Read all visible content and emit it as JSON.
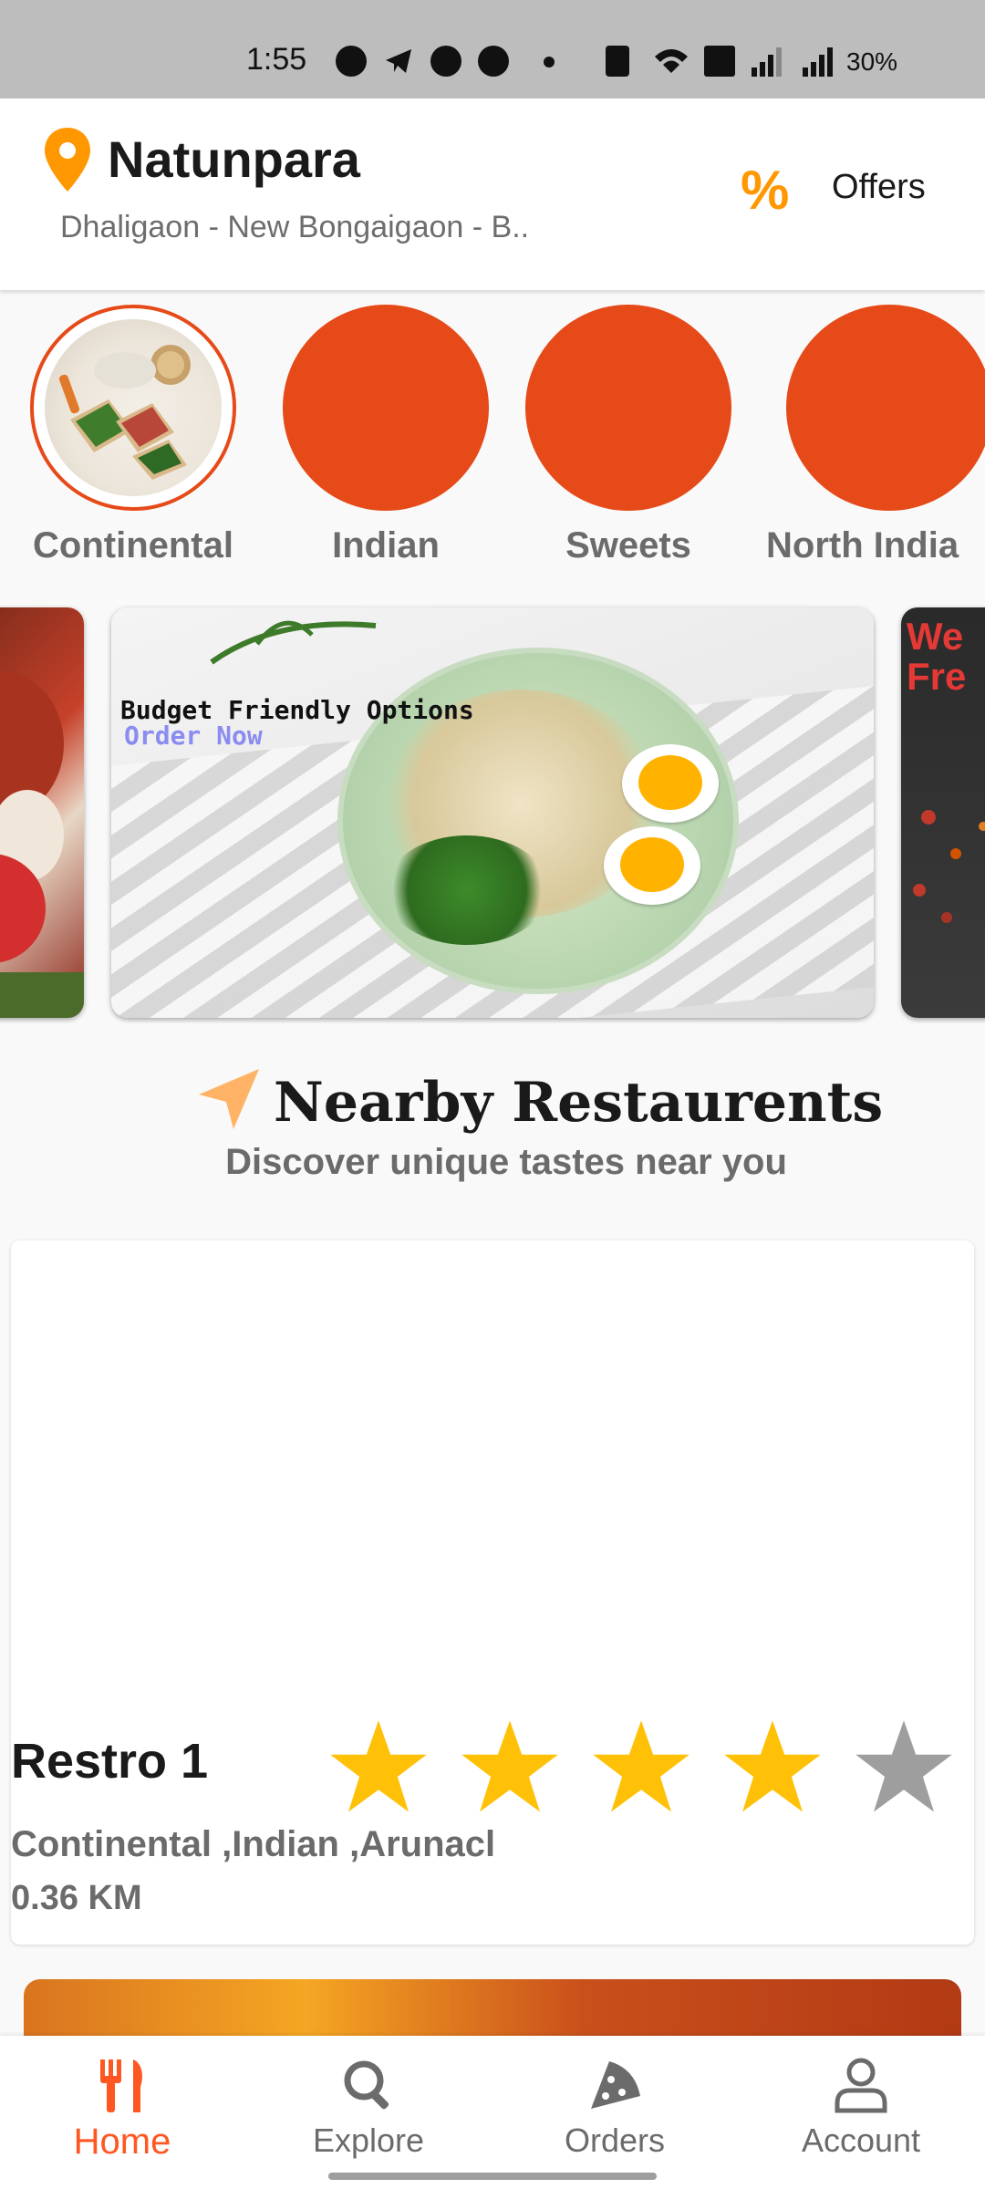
{
  "status_bar": {
    "time": "1:55",
    "battery": "30%"
  },
  "header": {
    "location_title": "Natunpara",
    "location_subtitle": "Dhaligaon - New Bongaigaon - B..",
    "offers_icon": "%",
    "offers_label": "Offers"
  },
  "categories": [
    {
      "label": "Continental",
      "selected": true
    },
    {
      "label": "Indian",
      "selected": false
    },
    {
      "label": "Sweets",
      "selected": false
    },
    {
      "label": "North India",
      "selected": false
    }
  ],
  "banner": {
    "title": "Budget Friendly Options",
    "cta": "Order Now",
    "right_text": "We\nFre"
  },
  "section": {
    "title": "Nearby Restaurents",
    "subtitle": "Discover unique tastes near you"
  },
  "restaurant": {
    "name": "Restro 1",
    "cuisines": "Continental ,Indian ,Arunacl",
    "distance": "0.36 KM",
    "rating": 4,
    "rating_max": 5
  },
  "bottom_nav": [
    {
      "label": "Home",
      "icon": "fork-knife-icon",
      "active": true
    },
    {
      "label": "Explore",
      "icon": "search-icon",
      "active": false
    },
    {
      "label": "Orders",
      "icon": "pizza-icon",
      "active": false
    },
    {
      "label": "Account",
      "icon": "person-icon",
      "active": false
    }
  ],
  "colors": {
    "accent": "#ff5722",
    "category_circle": "#e64a19",
    "offers": "#ff9800",
    "star_filled": "#ffc107",
    "star_empty": "#9e9e9e"
  }
}
